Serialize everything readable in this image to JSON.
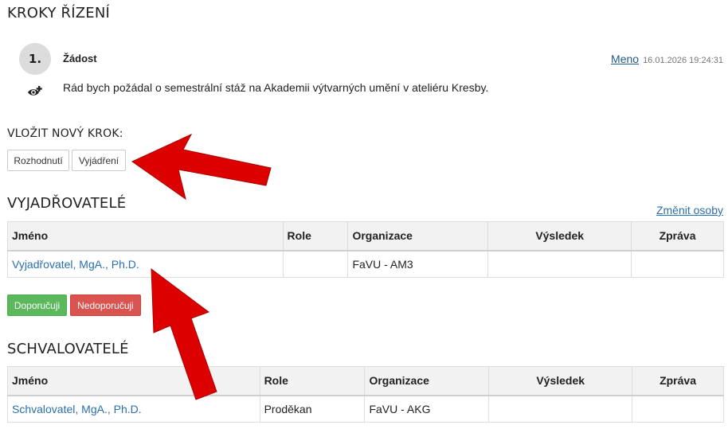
{
  "steps_title": "KROKY ŘÍZENÍ",
  "step": {
    "number": "1.",
    "name": "Žádost",
    "author": "Meno",
    "timestamp": "16.01.2026 19:24:31",
    "text": "Rád bych požádal o semestrální stáž na Akademii výtvarných umění v ateliéru Kresby."
  },
  "new_step": {
    "title": "VLOŽIT NOVÝ KROK:",
    "buttons": [
      "Rozhodnutí",
      "Vyjádření"
    ]
  },
  "commenters": {
    "title": "VYJADŘOVATELÉ",
    "change_link": "Změnit osoby",
    "columns": [
      "Jméno",
      "Role",
      "Organizace",
      "Výsledek",
      "Zpráva"
    ],
    "rows": [
      {
        "name": "Vyjadřovatel, MgA., Ph.D.",
        "role": "",
        "org": "FaVU - AM3",
        "result": "",
        "message": ""
      }
    ],
    "recommend_label": "Doporučuji",
    "not_recommend_label": "Nedoporučuji"
  },
  "approvers": {
    "title": "SCHVALOVATELÉ",
    "columns": [
      "Jméno",
      "Role",
      "Organizace",
      "Výsledek",
      "Zpráva"
    ],
    "rows": [
      {
        "name": "Schvalovatel, MgA., Ph.D.",
        "role": "Proděkan",
        "org": "FaVU - AKG",
        "result": "",
        "message": ""
      }
    ]
  },
  "colors": {
    "success": "#5cb85c",
    "danger": "#d9534f",
    "link": "#2a6fb0",
    "arrow": "#dd0000"
  },
  "icons": {
    "visibility": "eye-plus-icon",
    "annotation": "arrow-annotation"
  }
}
